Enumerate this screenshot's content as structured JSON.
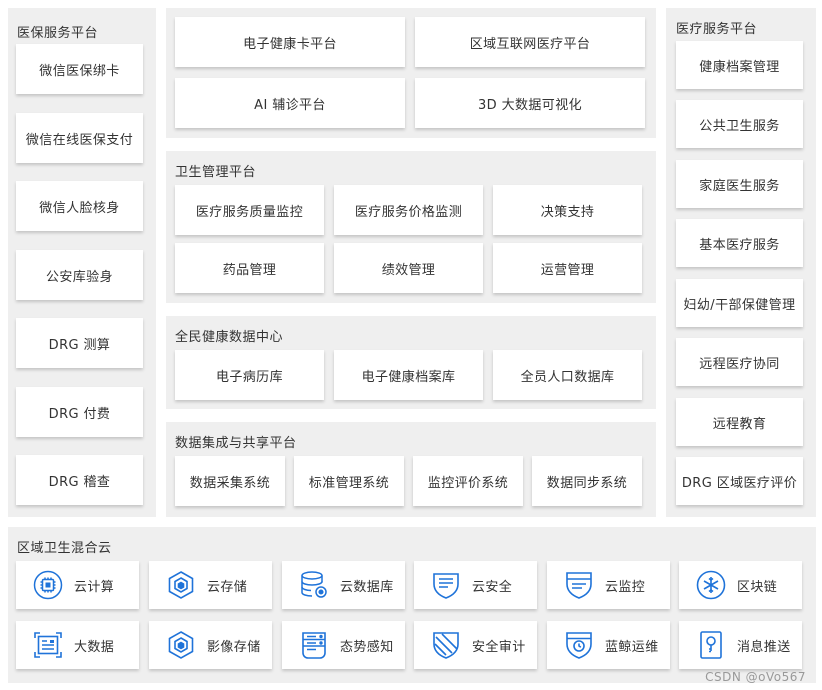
{
  "left_panel": {
    "title": "医保服务平台",
    "items": [
      "微信医保绑卡",
      "微信在线医保支付",
      "微信人脸核身",
      "公安库验身",
      "DRG 测算",
      "DRG 付费",
      "DRG 稽查"
    ]
  },
  "top_group": {
    "items": [
      "电子健康卡平台",
      "区域互联网医疗平台",
      "AI 辅诊平台",
      "3D 大数据可视化"
    ]
  },
  "health_mgmt": {
    "title": "卫生管理平台",
    "items": [
      "医疗服务质量监控",
      "医疗服务价格监测",
      "决策支持",
      "药品管理",
      "绩效管理",
      "运营管理"
    ]
  },
  "data_center": {
    "title": "全民健康数据中心",
    "items": [
      "电子病历库",
      "电子健康档案库",
      "全员人口数据库"
    ]
  },
  "integration": {
    "title": "数据集成与共享平台",
    "items": [
      "数据采集系统",
      "标准管理系统",
      "监控评价系统",
      "数据同步系统"
    ]
  },
  "right_panel": {
    "title": "医疗服务平台",
    "items": [
      "健康档案管理",
      "公共卫生服务",
      "家庭医生服务",
      "基本医疗服务",
      "妇幼/干部保健管理",
      "远程医疗协同",
      "远程教育",
      "DRG 区域医疗评价"
    ]
  },
  "cloud": {
    "title": "区域卫生混合云",
    "items": [
      {
        "label": "云计算",
        "icon": "chip-icon"
      },
      {
        "label": "云存储",
        "icon": "hexagon-storage-icon"
      },
      {
        "label": "云数据库",
        "icon": "database-icon"
      },
      {
        "label": "云安全",
        "icon": "shield-icon"
      },
      {
        "label": "云监控",
        "icon": "shield-monitor-icon"
      },
      {
        "label": "区块链",
        "icon": "snowflake-icon"
      },
      {
        "label": "大数据",
        "icon": "bigdata-icon"
      },
      {
        "label": "影像存储",
        "icon": "hexagon-image-icon"
      },
      {
        "label": "态势感知",
        "icon": "server-icon"
      },
      {
        "label": "安全审计",
        "icon": "audit-shield-icon"
      },
      {
        "label": "蓝鲸运维",
        "icon": "ops-shield-icon"
      },
      {
        "label": "消息推送",
        "icon": "message-icon"
      }
    ]
  },
  "watermark": "CSDN @oVo567",
  "colors": {
    "panel_bg": "#efefef",
    "card_bg": "#ffffff",
    "icon_blue": "#1f73d9"
  }
}
